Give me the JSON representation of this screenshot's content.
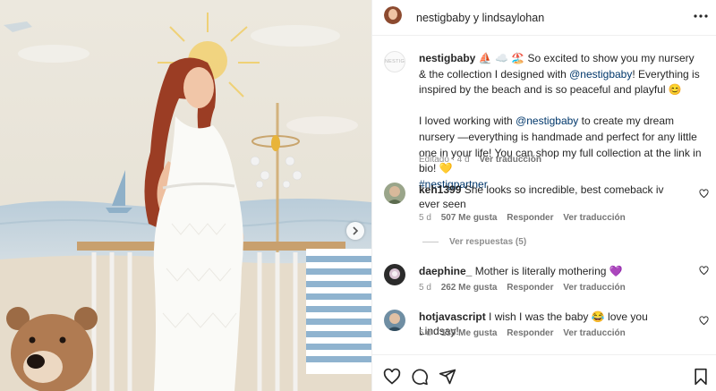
{
  "post": {
    "header_title": "nestigbaby y lindsaylohan",
    "brand_avatar_text": "NESTIG",
    "caption": {
      "username": "nestigbaby",
      "emojis": "⛵ ☁️ 🏖️",
      "line1_text": "So excited to show you my nursery & the collection I designed with",
      "mention1": "@nestigbaby",
      "line1_rest": "! Everything is inspired by the beach and is so peaceful and playful 😊",
      "para2_start": "I loved working with",
      "mention2": "@nestigbaby",
      "para2_rest": "to create my dream nursery —everything is handmade and perfect for any little one in your life! You can shop my full collection at the link in bio! 💛",
      "hashtag": "#nestigpartner",
      "edited": "Editado · 4 d",
      "translate": "Ver traducción"
    },
    "comments": [
      {
        "username": "keh1399",
        "text": "She looks so incredible, best comeback iv ever seen",
        "age": "5 d",
        "likes": "507 Me gusta",
        "reply": "Responder",
        "translate": "Ver traducción"
      },
      {
        "username": "daephine_",
        "text": "Mother is literally mothering 💜",
        "age": "5 d",
        "likes": "262 Me gusta",
        "reply": "Responder",
        "translate": "Ver traducción"
      },
      {
        "username": "hotjavascript",
        "text": "I wish I was the baby 😂 love you Lindsay!",
        "age": "5 d",
        "likes": "139 Me gusta",
        "reply": "Responder",
        "translate": "Ver traducción"
      }
    ],
    "view_replies": "Ver respuestas (5)"
  },
  "icons": {
    "more": "more-options-icon",
    "heart": "heart-icon",
    "comment": "comment-icon",
    "share": "share-icon",
    "save": "bookmark-icon",
    "next": "chevron-right-icon"
  },
  "colors": {
    "link": "#00376b",
    "meta": "#8e8e8e",
    "text": "#262626",
    "border": "#efefef"
  }
}
